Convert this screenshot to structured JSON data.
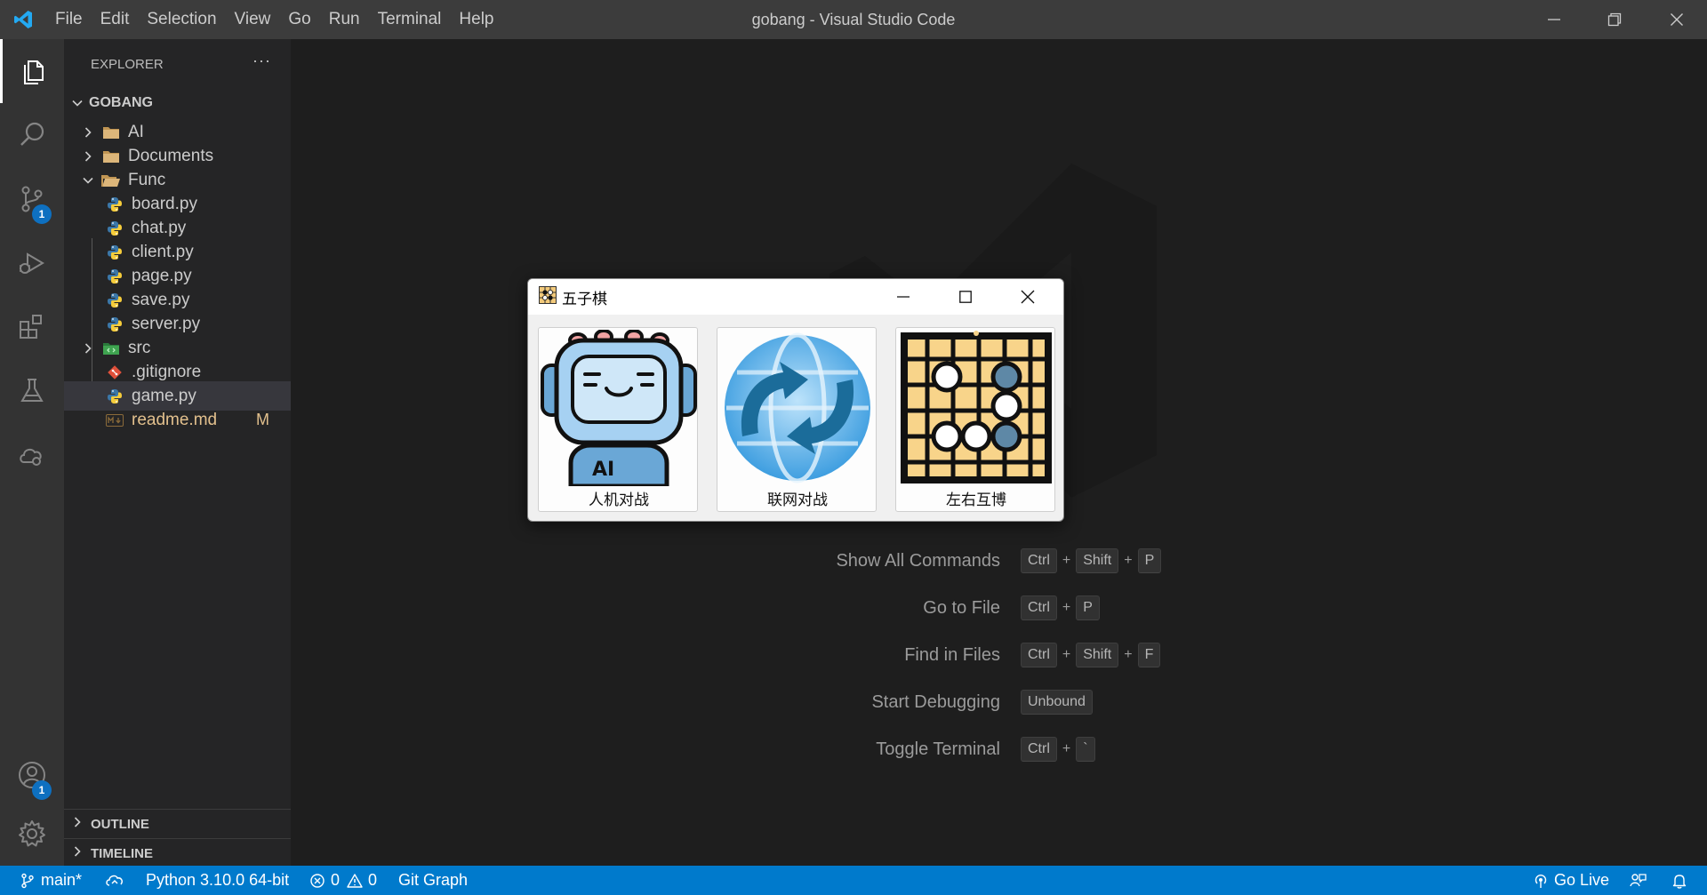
{
  "titlebar": {
    "menu": [
      "File",
      "Edit",
      "Selection",
      "View",
      "Go",
      "Run",
      "Terminal",
      "Help"
    ],
    "title": "gobang - Visual Studio Code"
  },
  "activitybar": {
    "source_control_badge": "1",
    "accounts_badge": "1"
  },
  "sidebar": {
    "header": "EXPLORER",
    "more": "···",
    "root": "GOBANG",
    "items": [
      {
        "label": "AI",
        "type": "folder"
      },
      {
        "label": "Documents",
        "type": "folder"
      },
      {
        "label": "Func",
        "type": "folder-open"
      },
      {
        "label": "board.py",
        "type": "python"
      },
      {
        "label": "chat.py",
        "type": "python"
      },
      {
        "label": "client.py",
        "type": "python"
      },
      {
        "label": "page.py",
        "type": "python"
      },
      {
        "label": "save.py",
        "type": "python"
      },
      {
        "label": "server.py",
        "type": "python"
      },
      {
        "label": "src",
        "type": "folder-src"
      },
      {
        "label": ".gitignore",
        "type": "git"
      },
      {
        "label": "game.py",
        "type": "python"
      },
      {
        "label": "readme.md",
        "type": "markdown",
        "badge": "M"
      }
    ],
    "outline": "OUTLINE",
    "timeline": "TIMELINE"
  },
  "shortcuts": [
    {
      "label": "Show All Commands",
      "keys": [
        "Ctrl",
        "Shift",
        "P"
      ]
    },
    {
      "label": "Go to File",
      "keys": [
        "Ctrl",
        "P"
      ]
    },
    {
      "label": "Find in Files",
      "keys": [
        "Ctrl",
        "Shift",
        "F"
      ]
    },
    {
      "label": "Start Debugging",
      "keys": [
        "Unbound"
      ]
    },
    {
      "label": "Toggle Terminal",
      "keys": [
        "Ctrl",
        "`"
      ]
    }
  ],
  "dialog": {
    "title": "五子棋",
    "modes": [
      {
        "label": "人机对战",
        "icon": "robot-ai-icon"
      },
      {
        "label": "联网对战",
        "icon": "globe-sync-icon"
      },
      {
        "label": "左右互博",
        "icon": "go-board-icon"
      }
    ]
  },
  "statusbar": {
    "branch": "main*",
    "python": "Python 3.10.0 64-bit",
    "errors": "0",
    "warnings": "0",
    "git_graph": "Git Graph",
    "go_live": "Go Live"
  },
  "colors": {
    "accent": "#007acc",
    "titlebar": "#3c3c3c",
    "sidebar": "#252526",
    "editor": "#1e1e1e",
    "modified": "#e2c08d"
  }
}
